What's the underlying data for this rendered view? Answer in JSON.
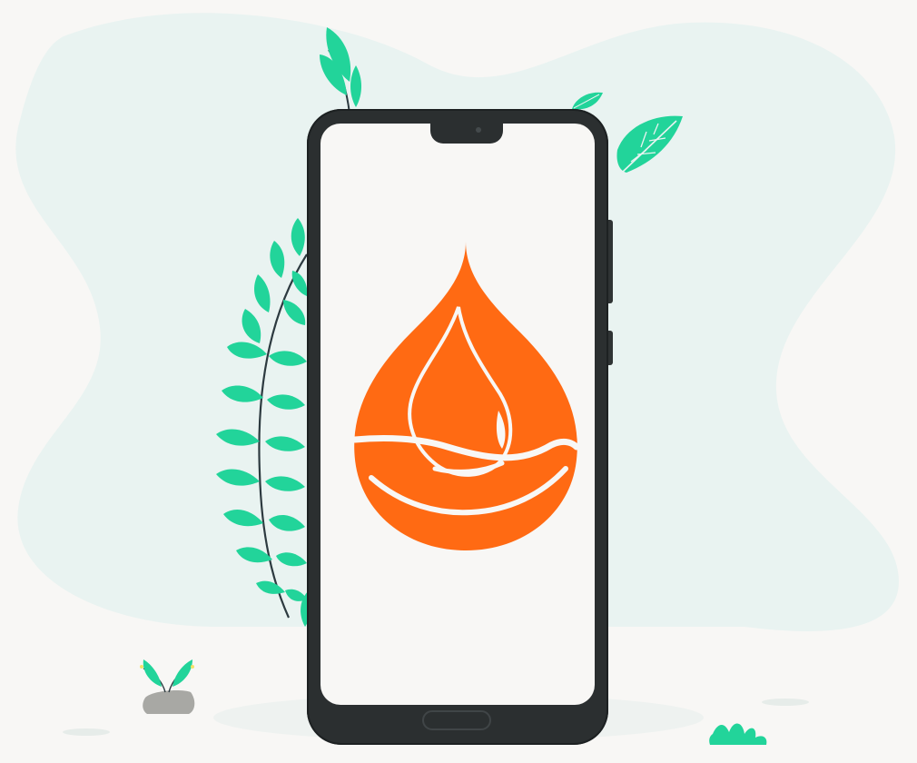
{
  "scene": {
    "description_colors": {
      "background": "#f8f7f5",
      "blob": "#e9f3f1",
      "leaf": "#22d49a",
      "stem": "#2d3a40",
      "phone_body": "#2b2f30",
      "logo": "#ff6a13"
    },
    "icons": [
      "blood-drop-hand-icon",
      "leaf-icon",
      "rock-icon"
    ]
  }
}
